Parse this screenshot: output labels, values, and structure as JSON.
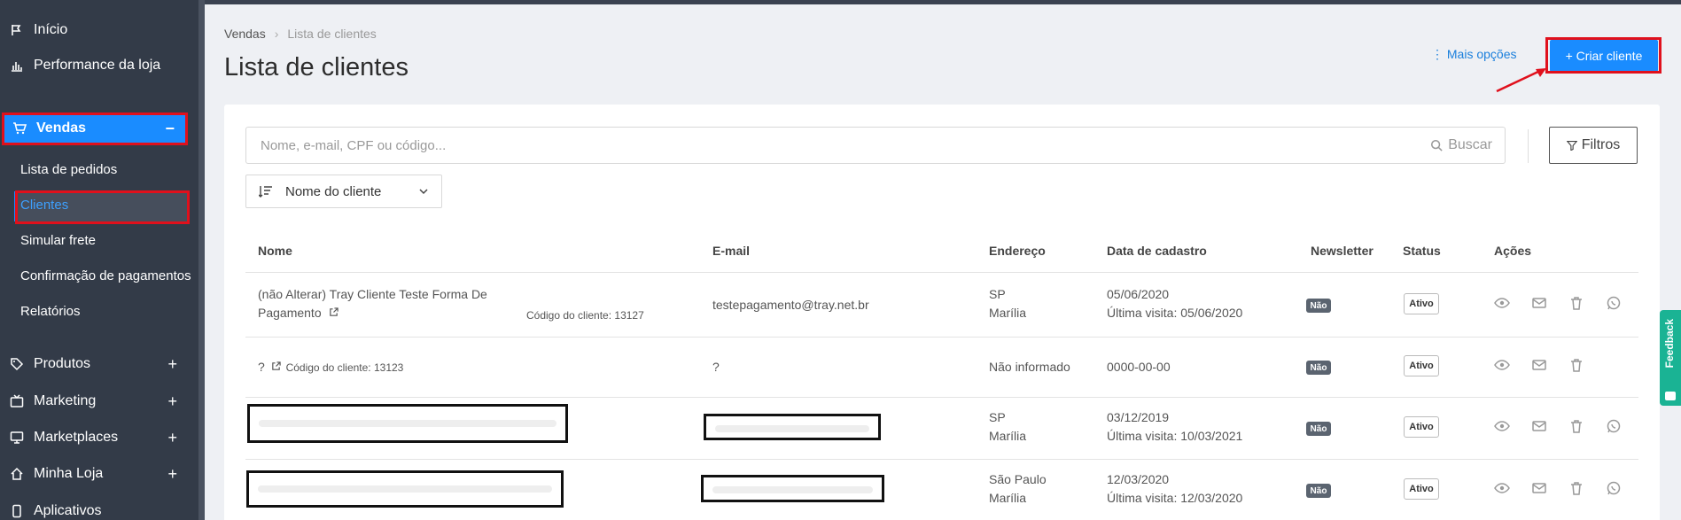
{
  "sidebar": {
    "inicio": "Início",
    "performance": "Performance da loja",
    "vendas": "Vendas",
    "vendas_toggle": "−",
    "sub": [
      "Lista de pedidos",
      "Clientes",
      "Simular frete",
      "Confirmação de pagamentos",
      "Relatórios"
    ],
    "produtos": "Produtos",
    "marketing": "Marketing",
    "marketplaces": "Marketplaces",
    "minha_loja": "Minha Loja",
    "aplicativos": "Aplicativos",
    "expand": "+"
  },
  "header": {
    "breadcrumb_root": "Vendas",
    "breadcrumb_sep": "›",
    "breadcrumb_current": "Lista de clientes",
    "title": "Lista de clientes",
    "more_options": "⋮ Mais opções",
    "create_button": "+ Criar cliente"
  },
  "search": {
    "placeholder": "Nome, e-mail, CPF ou código...",
    "button": "Buscar"
  },
  "filters_label": "Filtros",
  "sort_label": "Nome do cliente",
  "table": {
    "columns": [
      "Nome",
      "E-mail",
      "Endereço",
      "Data de cadastro",
      "Newsletter",
      "Status",
      "Ações"
    ],
    "rows": [
      {
        "name_line1": "(não Alterar) Tray Cliente Teste Forma De",
        "name_line2": "Pagamento",
        "code": "Código do cliente: 13127",
        "email": "testepagamento@tray.net.br",
        "state": "SP",
        "city": "Marília",
        "date": "05/06/2020",
        "last_visit": "Última visita: 05/06/2020",
        "newsletter": "Não",
        "status": "Ativo"
      },
      {
        "name_line1": "?",
        "code": "Código do cliente: 13123",
        "email": "?",
        "address": "Não informado",
        "date": "0000-00-00",
        "newsletter": "Não",
        "status": "Ativo"
      },
      {
        "state": "SP",
        "city": "Marília",
        "date": "03/12/2019",
        "last_visit": "Última visita: 10/03/2021",
        "newsletter": "Não",
        "status": "Ativo"
      },
      {
        "state": "São Paulo",
        "city": "Marília",
        "date": "12/03/2020",
        "last_visit": "Última visita: 12/03/2020",
        "newsletter": "Não",
        "status": "Ativo"
      }
    ]
  },
  "feedback_label": "Feedback",
  "colors": {
    "accent": "#1a8cff",
    "sidebar": "#333b48",
    "highlight": "#e0101c",
    "feedback": "#1ab394"
  },
  "icons": [
    "flag-icon",
    "bar-chart-icon",
    "cart-icon",
    "tag-icon",
    "tv-icon",
    "monitor-icon",
    "home-icon",
    "phone-icon",
    "search-icon",
    "filter-icon",
    "sort-icon",
    "chevron-down-icon",
    "eye-icon",
    "mail-icon",
    "trash-icon",
    "whatsapp-icon",
    "external-link-icon"
  ]
}
